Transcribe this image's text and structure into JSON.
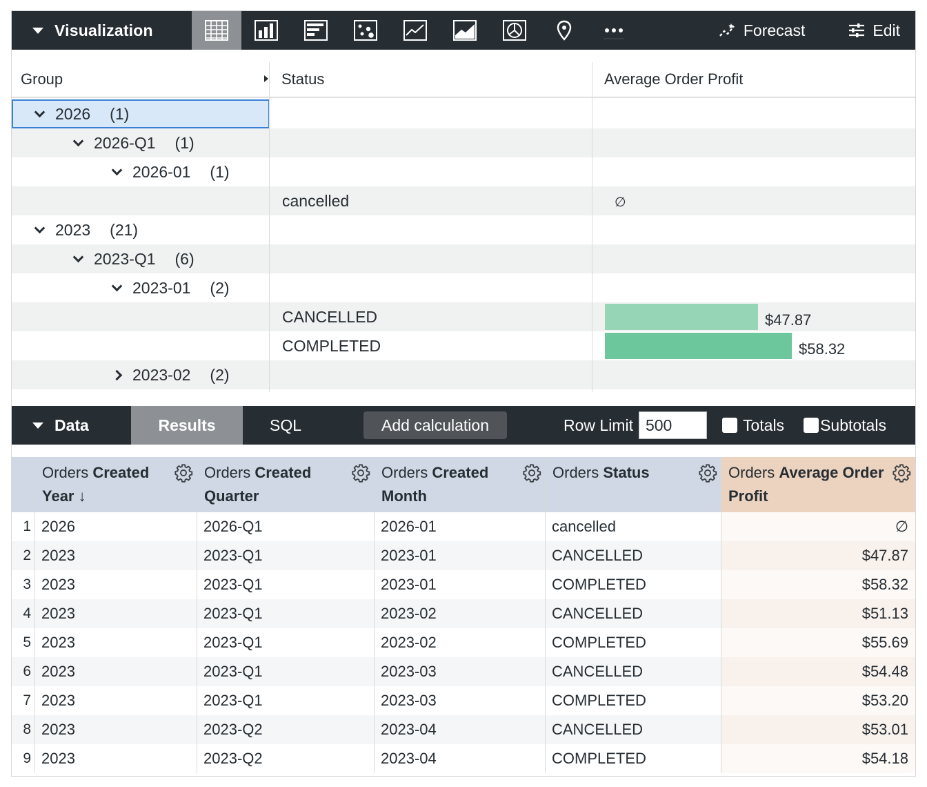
{
  "toolbar": {
    "title": "Visualization",
    "vis_icons": [
      "table-icon",
      "column-chart-icon",
      "bar-chart-icon",
      "scatter-chart-icon",
      "line-chart-icon",
      "area-chart-icon",
      "pie-chart-icon",
      "map-pin-icon",
      "more-icon"
    ],
    "forecast_label": "Forecast",
    "edit_label": "Edit"
  },
  "pivot": {
    "headers": {
      "group": "Group",
      "status": "Status",
      "measure": "Average Order Profit"
    },
    "rows": [
      {
        "level": 0,
        "label": "2026",
        "count": "(1)",
        "expanded": true,
        "selected": true
      },
      {
        "level": 1,
        "label": "2026-Q1",
        "count": "(1)",
        "expanded": true
      },
      {
        "level": 2,
        "label": "2026-01",
        "count": "(1)",
        "expanded": true
      },
      {
        "leaf": true,
        "status": "cancelled",
        "value": "∅",
        "is_null": true
      },
      {
        "level": 0,
        "label": "2023",
        "count": "(21)",
        "expanded": true
      },
      {
        "level": 1,
        "label": "2023-Q1",
        "count": "(6)",
        "expanded": true
      },
      {
        "level": 2,
        "label": "2023-01",
        "count": "(2)",
        "expanded": true
      },
      {
        "leaf": true,
        "status": "CANCELLED",
        "value": "$47.87",
        "amount": 47.87,
        "bar_color": "#96d6b7"
      },
      {
        "leaf": true,
        "status": "COMPLETED",
        "value": "$58.32",
        "amount": 58.32,
        "bar_color": "#6cc89c"
      },
      {
        "level": 2,
        "label": "2023-02",
        "count": "(2)",
        "expanded": false
      }
    ]
  },
  "databar": {
    "title": "Data",
    "tab_results": "Results",
    "tab_sql": "SQL",
    "add_calculation": "Add calculation",
    "row_limit_label": "Row Limit",
    "row_limit_value": "500",
    "totals_label": "Totals",
    "subtotals_label": "Subtotals"
  },
  "results": {
    "columns": [
      {
        "prefix": "Orders ",
        "bold": "Created",
        "line2": "Year ↓",
        "line2_bold": false
      },
      {
        "prefix": "Orders ",
        "bold": "Created",
        "line2": "Quarter",
        "line2_bold": true
      },
      {
        "prefix": "Orders ",
        "bold": "Created",
        "line2": "Month",
        "line2_bold": true
      },
      {
        "prefix": "Orders ",
        "bold": "Status",
        "line2": "",
        "line2_bold": false
      },
      {
        "prefix": "Orders ",
        "bold": "Average Order",
        "line2": "Profit",
        "line2_bold": true,
        "measure": true
      }
    ],
    "rows": [
      [
        "1",
        "2026",
        "2026-Q1",
        "2026-01",
        "cancelled",
        "∅"
      ],
      [
        "2",
        "2023",
        "2023-Q1",
        "2023-01",
        "CANCELLED",
        "$47.87"
      ],
      [
        "3",
        "2023",
        "2023-Q1",
        "2023-01",
        "COMPLETED",
        "$58.32"
      ],
      [
        "4",
        "2023",
        "2023-Q1",
        "2023-02",
        "CANCELLED",
        "$51.13"
      ],
      [
        "5",
        "2023",
        "2023-Q1",
        "2023-02",
        "COMPLETED",
        "$55.69"
      ],
      [
        "6",
        "2023",
        "2023-Q1",
        "2023-03",
        "CANCELLED",
        "$54.48"
      ],
      [
        "7",
        "2023",
        "2023-Q1",
        "2023-03",
        "COMPLETED",
        "$53.20"
      ],
      [
        "8",
        "2023",
        "2023-Q2",
        "2023-04",
        "CANCELLED",
        "$53.01"
      ],
      [
        "9",
        "2023",
        "2023-Q2",
        "2023-04",
        "COMPLETED",
        "$54.18"
      ]
    ]
  }
}
